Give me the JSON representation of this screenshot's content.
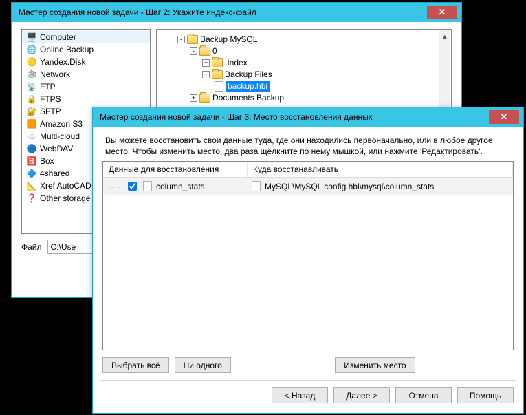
{
  "windows": {
    "step2": {
      "title": "Мастер создания новой задачи - Шаг 2: Укажите индекс-файл",
      "storage": [
        {
          "id": "computer",
          "label": "Computer",
          "emoji": "🖥️",
          "sel": true
        },
        {
          "id": "online-backup",
          "label": "Online Backup",
          "emoji": "🌐"
        },
        {
          "id": "yandex-disk",
          "label": "Yandex.Disk",
          "emoji": "🟡"
        },
        {
          "id": "network",
          "label": "Network",
          "emoji": "🕸️"
        },
        {
          "id": "ftp",
          "label": "FTP",
          "emoji": "📡"
        },
        {
          "id": "ftps",
          "label": "FTPS",
          "emoji": "🔒"
        },
        {
          "id": "sftp",
          "label": "SFTP",
          "emoji": "🔐"
        },
        {
          "id": "s3",
          "label": "Amazon S3",
          "emoji": "🟧"
        },
        {
          "id": "multicloud",
          "label": "Multi-cloud",
          "emoji": "☁️"
        },
        {
          "id": "webdav",
          "label": "WebDAV",
          "emoji": "🔵"
        },
        {
          "id": "box",
          "label": "Box",
          "emoji": "🅱️"
        },
        {
          "id": "4shared",
          "label": "4shared",
          "emoji": "🔷"
        },
        {
          "id": "xref",
          "label": "Xref AutoCAD t",
          "emoji": "📐"
        },
        {
          "id": "other",
          "label": "Other storage p",
          "emoji": "❓"
        }
      ],
      "tree": {
        "root": {
          "label": "Backup MySQL",
          "exp": "-"
        },
        "zero": {
          "label": "0",
          "exp": "-"
        },
        "index": {
          "label": ".Index",
          "exp": "+"
        },
        "backup_files": {
          "label": "Backup Files",
          "exp": "+"
        },
        "backup_hbi": {
          "label": "backup.hbi"
        },
        "docs": {
          "label": "Documents Backup",
          "exp": "+"
        }
      },
      "file_label": "Файл",
      "file_value": "C:\\Use"
    },
    "step3": {
      "title": "Мастер создания новой задачи - Шаг 3: Место восстановления данных",
      "hint": "Вы можете восстановить свои данные туда, где они находились первоначально, или в любое другое место. Чтобы изменить место, два раза щёлкните по нему мышкой, или нажмите 'Редактировать'.",
      "columns": {
        "a": "Данные для восстановления",
        "b": "Куда восстанавливать"
      },
      "row": {
        "checked": true,
        "name": "column_stats",
        "dest": "MySQL\\MySQL config.hbl\\mysql\\column_stats"
      },
      "buttons": {
        "select_all": "Выбрать всё",
        "select_none": "Ни одного",
        "change_dest": "Изменить место",
        "back": "< Назад",
        "next": "Далее >",
        "cancel": "Отмена",
        "help": "Помощь"
      }
    }
  }
}
